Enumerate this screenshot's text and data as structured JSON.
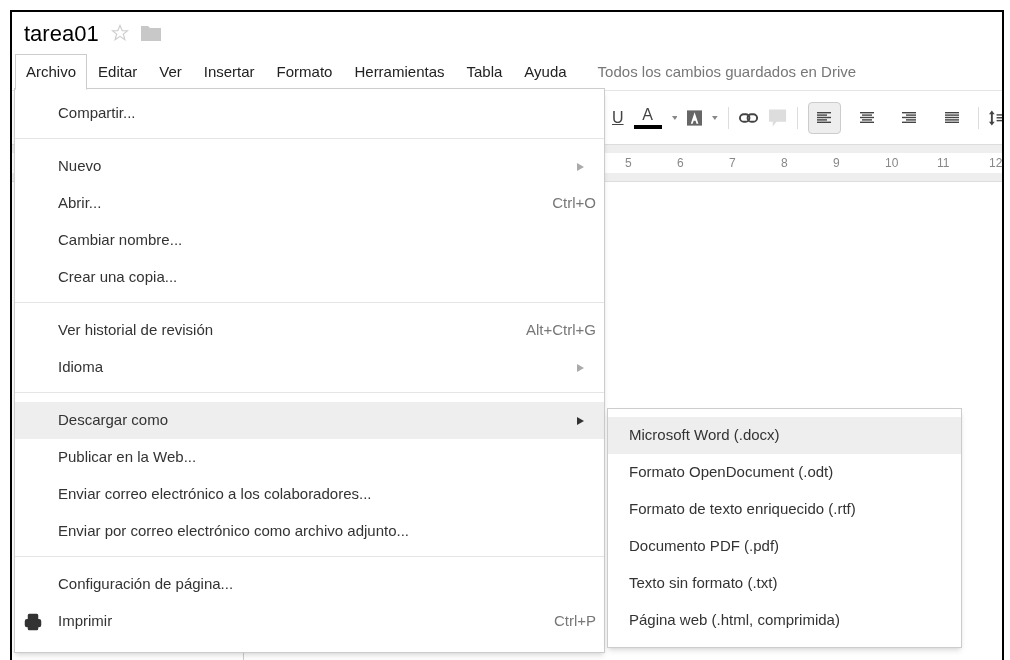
{
  "document": {
    "title": "tarea01",
    "starred": false
  },
  "menubar": [
    {
      "label": "Archivo",
      "selected": true
    },
    {
      "label": "Editar",
      "selected": false
    },
    {
      "label": "Ver",
      "selected": false
    },
    {
      "label": "Insertar",
      "selected": false
    },
    {
      "label": "Formato",
      "selected": false
    },
    {
      "label": "Herramientas",
      "selected": false
    },
    {
      "label": "Tabla",
      "selected": false
    },
    {
      "label": "Ayuda",
      "selected": false
    }
  ],
  "save_status": "Todos los cambios guardados en Drive",
  "toolbar": {
    "underline": "U",
    "text_color": "A",
    "align_buttons": [
      {
        "kind": "left",
        "selected": true
      },
      {
        "kind": "center",
        "selected": false
      },
      {
        "kind": "right",
        "selected": false
      },
      {
        "kind": "justify",
        "selected": false
      }
    ]
  },
  "ruler": [
    "5",
    "6",
    "7",
    "8",
    "9",
    "10",
    "11",
    "12"
  ],
  "file_menu": [
    [
      {
        "label": "Compartir...",
        "selected": false
      }
    ],
    [
      {
        "label": "Nuevo",
        "submenu": true,
        "selected": false
      },
      {
        "label": "Abrir...",
        "shortcut": "Ctrl+O",
        "selected": false
      },
      {
        "label": "Cambiar nombre...",
        "selected": false
      },
      {
        "label": "Crear una copia...",
        "selected": false
      }
    ],
    [
      {
        "label": "Ver historial de revisión",
        "shortcut": "Alt+Ctrl+G",
        "selected": false
      },
      {
        "label": "Idioma",
        "submenu": true,
        "selected": false
      }
    ],
    [
      {
        "label": "Descargar como",
        "submenu": true,
        "selected": true
      },
      {
        "label": "Publicar en la Web...",
        "selected": false
      },
      {
        "label": "Enviar correo electrónico a los colaboradores...",
        "selected": false
      },
      {
        "label": "Enviar por correo electrónico como archivo adjunto...",
        "selected": false
      }
    ],
    [
      {
        "label": "Configuración de página...",
        "selected": false
      },
      {
        "label": "Imprimir",
        "shortcut": "Ctrl+P",
        "kind": "print",
        "selected": false
      }
    ]
  ],
  "download_submenu": [
    {
      "label": "Microsoft Word (.docx)",
      "selected": true
    },
    {
      "label": "Formato OpenDocument (.odt)",
      "selected": false
    },
    {
      "label": "Formato de texto enriquecido (.rtf)",
      "selected": false
    },
    {
      "label": "Documento PDF (.pdf)",
      "selected": false
    },
    {
      "label": "Texto sin formato (.txt)",
      "selected": false
    },
    {
      "label": "Página web (.html, comprimida)",
      "selected": false
    }
  ]
}
